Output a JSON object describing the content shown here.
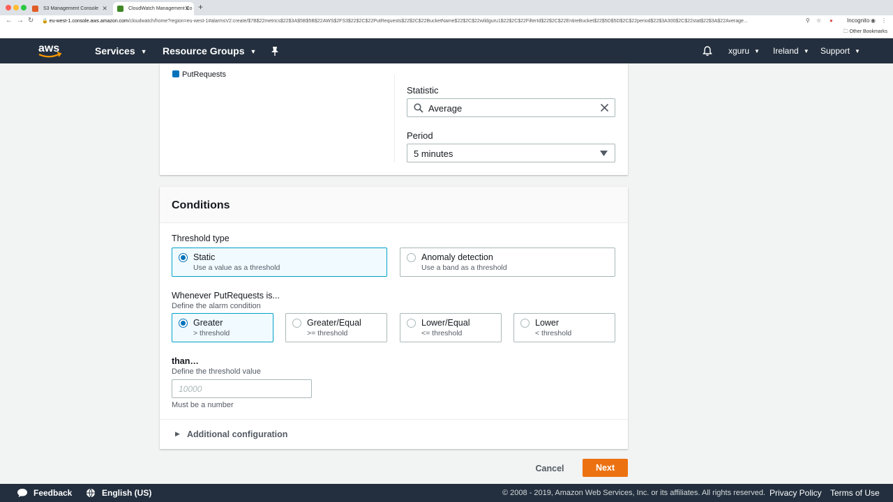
{
  "browser": {
    "tabs": [
      {
        "title": "S3 Management Console",
        "active": false
      },
      {
        "title": "CloudWatch Management Co",
        "active": true
      }
    ],
    "url_host": "eu-west-1.console.aws.amazon.com",
    "url_path": "/cloudwatch/home?region=eu-west-1#alarmsV2:create/$7B$22metrics$22$3A$5B$5B$22AWS$2FS3$22$2C$22PutRequests$22$2C$22BucketName$22$2C$22wildguru1$22$2C$22FilterId$22$2C$22EntireBucket$22$5D$5D$2C$22period$22$3A300$2C$22stat$22$3A$22Average...",
    "incognito_label": "Incognito",
    "bookmarks_label": "Other Bookmarks"
  },
  "nav": {
    "logo_text": "aws",
    "services": "Services",
    "resource_groups": "Resource Groups",
    "user": "xguru",
    "region": "Ireland",
    "support": "Support"
  },
  "metric": {
    "series_label": "PutRequests",
    "statistic_label": "Statistic",
    "statistic_value": "Average",
    "period_label": "Period",
    "period_value": "5 minutes"
  },
  "conditions": {
    "title": "Conditions",
    "threshold_type_label": "Threshold type",
    "threshold_types": [
      {
        "name": "Static",
        "desc": "Use a value as a threshold",
        "selected": true
      },
      {
        "name": "Anomaly detection",
        "desc": "Use a band as a threshold",
        "selected": false
      }
    ],
    "whenever_label": "Whenever PutRequests is...",
    "whenever_hint": "Define the alarm condition",
    "operators": [
      {
        "name": "Greater",
        "desc": "> threshold",
        "selected": true
      },
      {
        "name": "Greater/Equal",
        "desc": ">= threshold",
        "selected": false
      },
      {
        "name": "Lower/Equal",
        "desc": "<= threshold",
        "selected": false
      },
      {
        "name": "Lower",
        "desc": "< threshold",
        "selected": false
      }
    ],
    "than_label": "than…",
    "than_hint": "Define the threshold value",
    "threshold_placeholder": "10000",
    "threshold_value": "",
    "threshold_constraint": "Must be a number",
    "additional_config": "Additional configuration"
  },
  "actions": {
    "cancel": "Cancel",
    "next": "Next"
  },
  "footer": {
    "feedback": "Feedback",
    "language": "English (US)",
    "copyright": "© 2008 - 2019, Amazon Web Services, Inc. or its affiliates. All rights reserved.",
    "privacy": "Privacy Policy",
    "terms": "Terms of Use"
  },
  "colors": {
    "nav_bg": "#232f3e",
    "primary_button": "#ec7211",
    "selection_blue": "#0073bb",
    "selected_tile_border": "#00a1c9"
  }
}
